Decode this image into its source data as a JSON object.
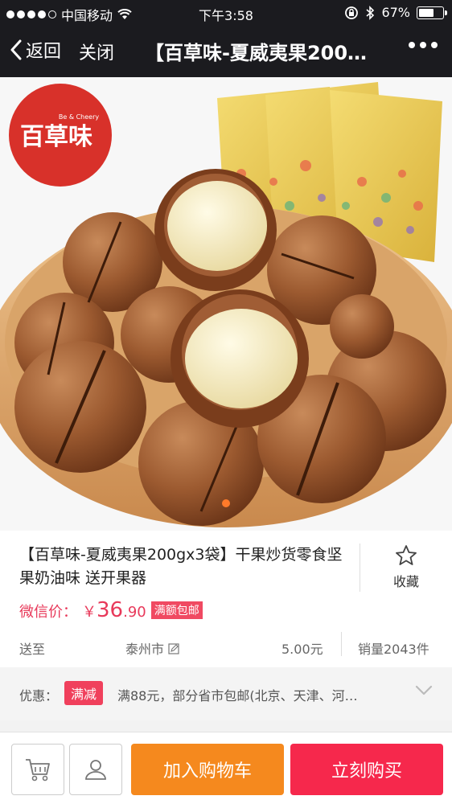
{
  "status_bar": {
    "carrier": "中国移动",
    "time": "下午3:58",
    "battery": "67%",
    "battery_level": 0.67
  },
  "nav": {
    "back_label": "返回",
    "close_label": "关闭",
    "title": "【百草味-夏威夷果200…"
  },
  "hero": {
    "brand_logo_text": "百草味",
    "brand_logo_subtext": "Be & Cheery"
  },
  "product": {
    "title": "【百草味-夏威夷果200gx3袋】干果炒货零食坚果奶油味 送开果器",
    "favorite_label": "收藏",
    "price_label": "微信价：",
    "currency": "￥",
    "price_int": "36",
    "price_dec": ".90",
    "free_shipping_badge": "满额包邮"
  },
  "shipping": {
    "to_label": "送至",
    "city": "泰州市",
    "fee": "5.00元",
    "sales": "销量2043件"
  },
  "promo": {
    "label": "优惠：",
    "tag": "满减",
    "text": "满88元，部分省市包邮(北京、天津、河…"
  },
  "bottom": {
    "add_to_cart": "加入购物车",
    "buy_now": "立刻购买"
  },
  "colors": {
    "accent_red": "#e8395a",
    "cart_orange": "#f5891e",
    "buy_red": "#f6284c",
    "bar_dark": "#1b1b1f"
  }
}
